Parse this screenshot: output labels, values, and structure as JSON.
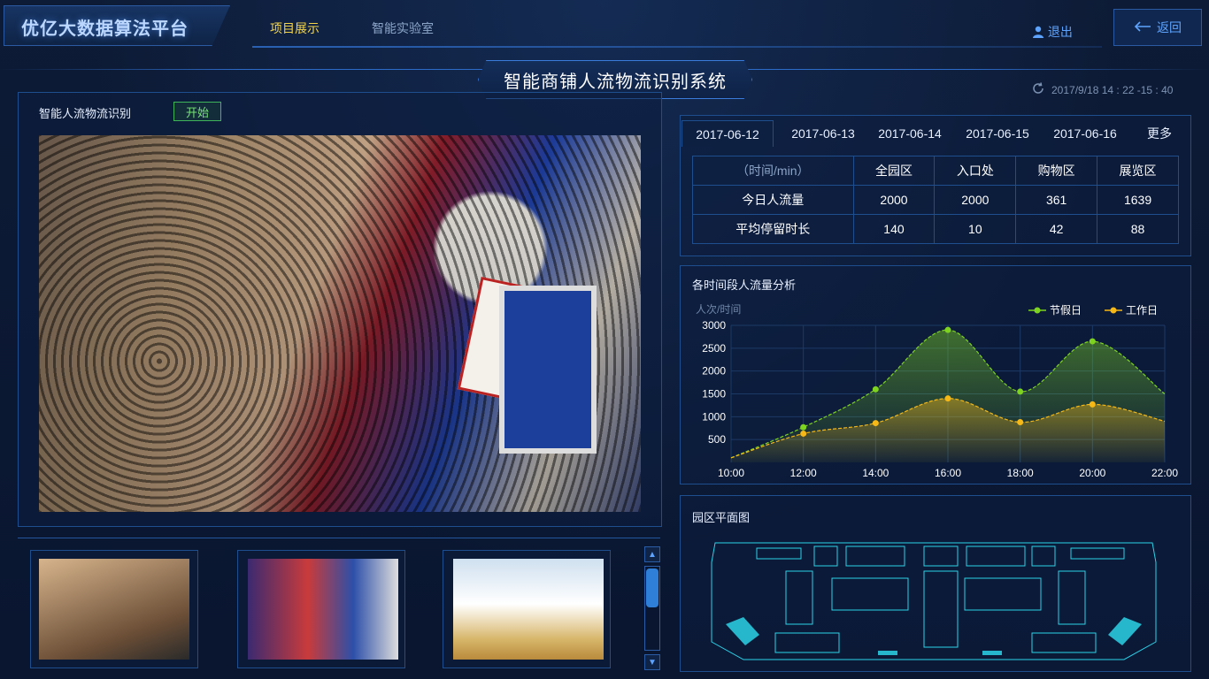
{
  "brand": {
    "title": "优亿大数据算法平台"
  },
  "nav": {
    "items": [
      {
        "label": "项目展示",
        "active": true
      },
      {
        "label": "智能实验室",
        "active": false
      }
    ],
    "logout_label": "退出",
    "back_label": "返回"
  },
  "page": {
    "title": "智能商铺人流物流识别系统",
    "datetime": "2017/9/18  14 : 22  -15 : 40"
  },
  "video_panel": {
    "title": "智能人流物流识别",
    "start_label": "开始"
  },
  "dates": {
    "tabs": [
      "2017-06-12",
      "2017-06-13",
      "2017-06-14",
      "2017-06-15",
      "2017-06-16"
    ],
    "active_index": 0,
    "more_label": "更多"
  },
  "stats_table": {
    "headers": [
      "（时间/min）",
      "全园区",
      "入口处",
      "购物区",
      "展览区"
    ],
    "rows": [
      {
        "label": "今日人流量",
        "values": [
          "2000",
          "2000",
          "361",
          "1639"
        ]
      },
      {
        "label": "平均停留时长",
        "values": [
          "140",
          "10",
          "42",
          "88"
        ]
      }
    ]
  },
  "chart_panel": {
    "title": "各时间段人流量分析"
  },
  "chart_data": {
    "type": "line",
    "title": "各时间段人流量分析",
    "ylabel": "人次/时间",
    "x": [
      "10:00",
      "12:00",
      "14:00",
      "16:00",
      "18:00",
      "20:00",
      "22:00"
    ],
    "y_ticks": [
      "3000",
      "2500",
      "2000",
      "1500",
      "1000",
      "500"
    ],
    "ylim": [
      0,
      3000
    ],
    "grid": true,
    "legend_position": "top-right",
    "series": [
      {
        "name": "节假日",
        "color": "#7ed321",
        "values": [
          100,
          770,
          1600,
          2900,
          1550,
          2650,
          1500
        ]
      },
      {
        "name": "工作日",
        "color": "#f5b817",
        "values": [
          100,
          630,
          860,
          1400,
          880,
          1270,
          900
        ]
      }
    ]
  },
  "floor_panel": {
    "title": "园区平面图"
  },
  "colors": {
    "accent": "#2d6bc9",
    "nav_active": "#f5d54a",
    "start": "#79e07a",
    "floor_line": "#2bd3e8"
  }
}
